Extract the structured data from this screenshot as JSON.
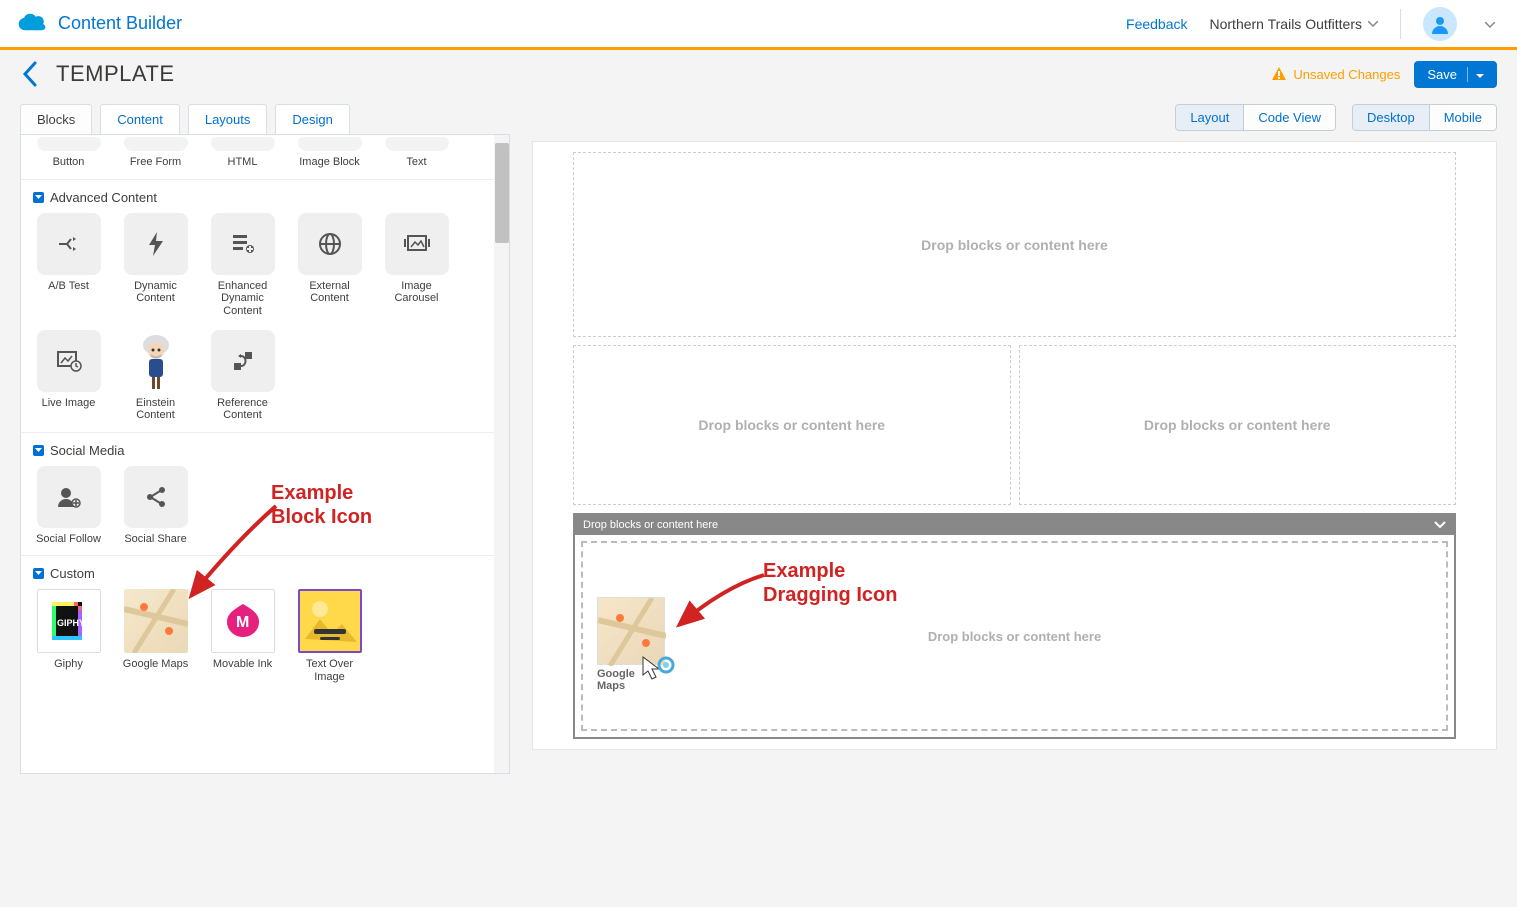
{
  "header": {
    "app_title": "Content Builder",
    "feedback": "Feedback",
    "org_name": "Northern Trails Outfitters"
  },
  "actionbar": {
    "page_title": "TEMPLATE",
    "warning": "Unsaved Changes",
    "save": "Save"
  },
  "tabs": [
    "Blocks",
    "Content",
    "Layouts",
    "Design"
  ],
  "basic_blocks": {
    "items": [
      "Button",
      "Free Form",
      "HTML",
      "Image Block",
      "Text"
    ]
  },
  "advanced": {
    "title": "Advanced Content",
    "items": [
      {
        "label": "A/B Test",
        "icon": "ab"
      },
      {
        "label": "Dynamic Content",
        "icon": "bolt"
      },
      {
        "label": "Enhanced Dynamic Content",
        "icon": "edc"
      },
      {
        "label": "External Content",
        "icon": "globe"
      },
      {
        "label": "Image Carousel",
        "icon": "carousel"
      },
      {
        "label": "Live Image",
        "icon": "liveimg"
      },
      {
        "label": "Einstein Content",
        "icon": "einstein"
      },
      {
        "label": "Reference Content",
        "icon": "ref"
      }
    ]
  },
  "social": {
    "title": "Social Media",
    "items": [
      {
        "label": "Social Follow",
        "icon": "follow"
      },
      {
        "label": "Social Share",
        "icon": "share"
      }
    ]
  },
  "custom": {
    "title": "Custom",
    "items": [
      {
        "label": "Giphy",
        "icon": "giphy"
      },
      {
        "label": "Google Maps",
        "icon": "gmaps"
      },
      {
        "label": "Movable Ink",
        "icon": "mink"
      },
      {
        "label": "Text Over Image",
        "icon": "toi"
      }
    ]
  },
  "view_toggles": {
    "group1": [
      "Layout",
      "Code View"
    ],
    "group2": [
      "Desktop",
      "Mobile"
    ]
  },
  "dropzone_text": "Drop blocks or content here",
  "drag_ghost_label": "Google Maps",
  "annotations": {
    "block_icon": "Example\nBlock Icon",
    "dragging_icon": "Example\nDragging Icon"
  }
}
